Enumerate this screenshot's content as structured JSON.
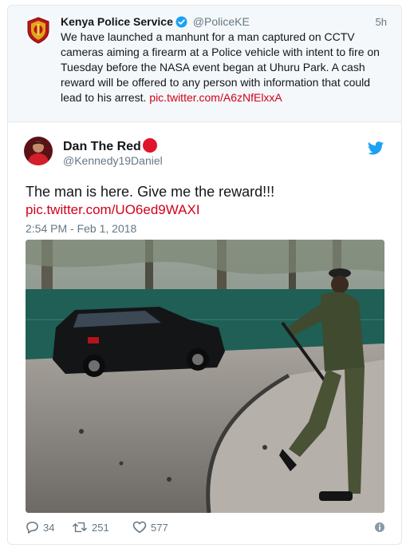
{
  "quoted_tweet": {
    "name": "Kenya Police Service",
    "handle": "@PoliceKE",
    "time": "5h",
    "text": "We have launched a manhunt for a man captured on CCTV cameras aiming a firearm at a Police vehicle with intent to fire on Tuesday before the NASA event began at Uhuru Park. A cash reward will be offered to any person with information that could lead to his arrest.",
    "link": "pic.twitter.com/A6zNfElxxA",
    "avatar_icon": "police-crest-icon",
    "verified_icon": "verified-badge-icon"
  },
  "tweet": {
    "name": "Dan The Red",
    "name_emoji": "red-circle-icon",
    "handle": "@Kennedy19Daniel",
    "text": "The man is here.  Give me the reward!!!",
    "link": "pic.twitter.com/UO6ed9WAXI",
    "timestamp": "2:54 PM - Feb 1, 2018",
    "brand_icon": "twitter-bird-icon",
    "accent_color": "#1da1f2",
    "link_color": "#d0021b"
  },
  "actions": {
    "replies": "34",
    "retweets": "251",
    "likes": "577",
    "reply_icon": "reply-icon",
    "retweet_icon": "retweet-icon",
    "like_icon": "heart-icon",
    "info_icon": "info-icon"
  }
}
